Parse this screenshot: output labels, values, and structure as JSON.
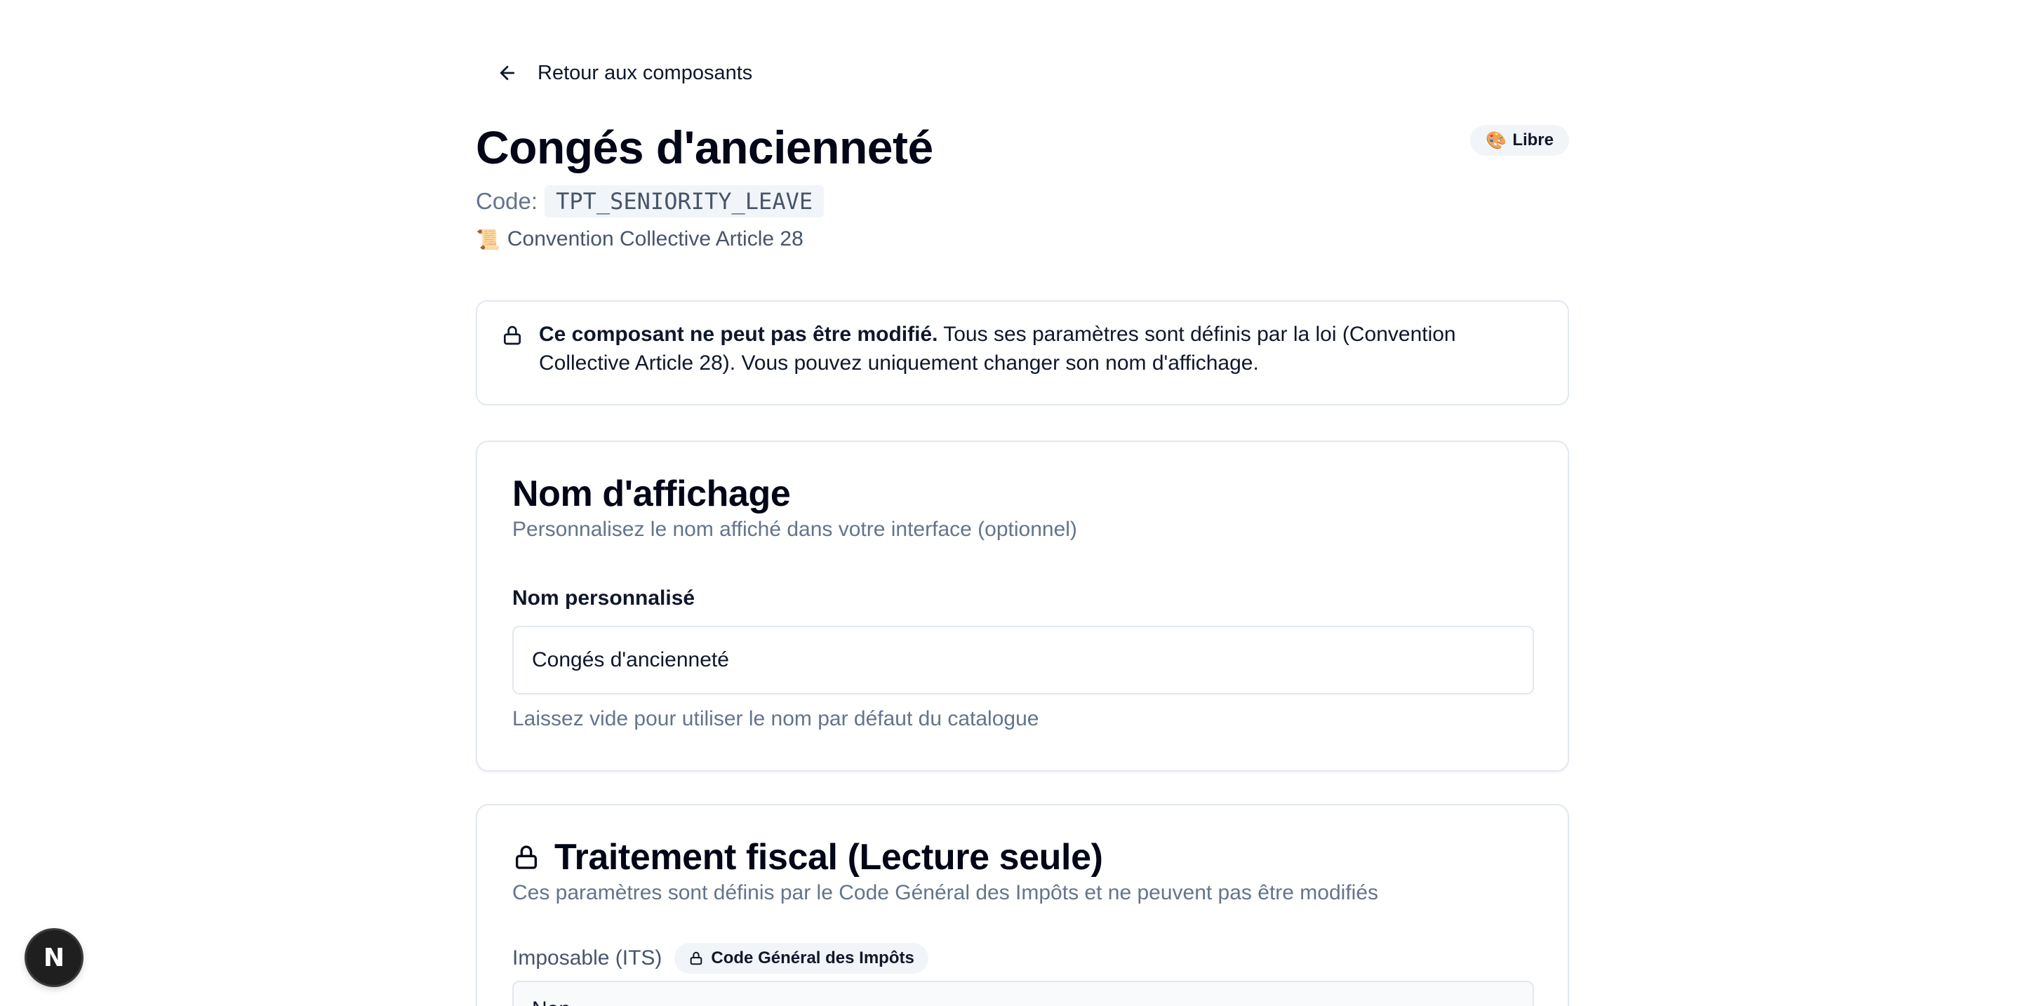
{
  "nav": {
    "back_label": "Retour aux composants"
  },
  "header": {
    "title": "Congés d'ancienneté",
    "badge_icon": "palette-icon",
    "badge_label": "Libre",
    "code_label": "Code:",
    "code_value": "TPT_SENIORITY_LEAVE",
    "source_icon": "scroll-icon",
    "source_label": "Convention Collective Article 28"
  },
  "alert": {
    "bold": "Ce composant ne peut pas être modifié.",
    "text": " Tous ses paramètres sont définis par la loi (Convention Collective Article 28). Vous pouvez uniquement changer son nom d'affichage."
  },
  "display_name_card": {
    "title": "Nom d'affichage",
    "description": "Personnalisez le nom affiché dans votre interface (optionnel)",
    "field_label": "Nom personnalisé",
    "field_value": "Congés d'ancienneté",
    "helper": "Laissez vide pour utiliser le nom par défaut du catalogue"
  },
  "fiscal_card": {
    "title": "Traitement fiscal (Lecture seule)",
    "description": "Ces paramètres sont définis par le Code Général des Impôts et ne peuvent pas être modifiés",
    "imposable_label": "Imposable (ITS)",
    "imposable_badge": "Code Général des Impôts",
    "imposable_value": "Non"
  },
  "dev_badge": {
    "letter": "N"
  },
  "colors": {
    "border": "#e2e8f0",
    "muted": "#64748b",
    "chip_bg": "#f1f5f9",
    "text": "#0f172a"
  }
}
